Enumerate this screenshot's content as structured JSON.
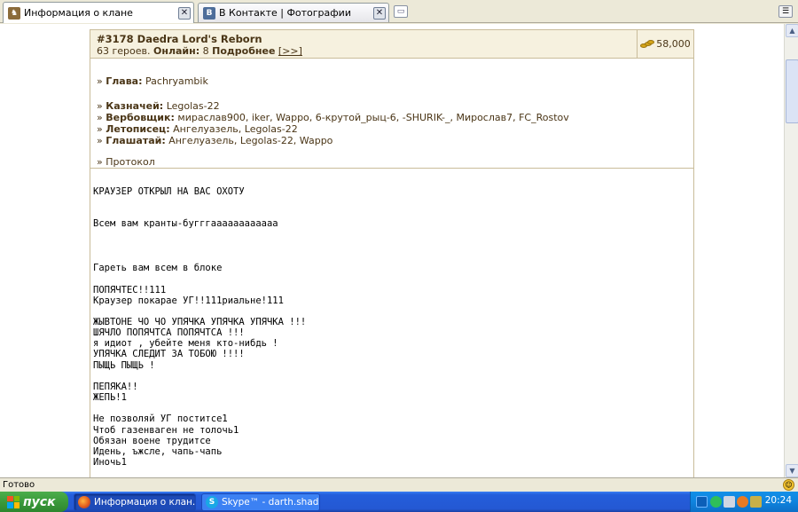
{
  "tabs": [
    {
      "title": "Информация о клане",
      "icon": "clan-icon",
      "close": "✕"
    },
    {
      "title": "В Контакте | Фотографии",
      "icon": "vk-icon",
      "close": "✕"
    }
  ],
  "clan": {
    "title": "#3178 Daedra Lord's Reborn",
    "heroes": "63 героев.",
    "online_label": "Онлайн:",
    "online_count": "8",
    "more_label": "Подробнее",
    "more_link": "[>>]",
    "gold": "58,000"
  },
  "officers": [
    {
      "prefix": "» ",
      "role": "Глава:",
      "names": "Pachryambik"
    },
    {
      "prefix": "» ",
      "role": "Казначей:",
      "names": "Legolas-22"
    },
    {
      "prefix": "» ",
      "role": "Вербовщик:",
      "names": "мираслав900, iker, Wappo, 6-крутой_рыц-6, -SHURIK-_, Мирослав7, FC_Rostov"
    },
    {
      "prefix": "» ",
      "role": "Летописец:",
      "names": "Ангелуазель, Legolas-22"
    },
    {
      "prefix": "» ",
      "role": "Глашатай:",
      "names": "Ангелуазель, Legolas-22, Wappo"
    }
  ],
  "protocol_link": "» Протокол",
  "history_lines": [
    "КРАУЗЕР ОТКРЫЛ НА ВАС ОХОТУ",
    "Всем вам кранты-бугггaааааааааааа",
    "Гареть вам всем в блоке",
    "ПОПЯЧТЕС!!111",
    "Краузер покарае УГ!!111риальне!111",
    "ЖЫВТОНЕ ЧО ЧО УПЯЧКА УПЯЧКА УПЯЧКА !!!",
    "ШЯЧЛО ПОПЯЧТСА ПОПЯЧТСА !!!",
    "я идиот , убейте меня кто-нибдь !",
    "УПЯЧКА СЛЕДИТ ЗА ТОБОЮ !!!!",
    "ПЫЩЬ ПЫЩЬ !",
    "ПЕПЯКА!!",
    "ЖЕПЬ!1",
    "Не позволяй УГ поститсе1",
    "Чтоб газенваген не толочь1",
    "Обязан воене трудитсе",
    "Идень, ъжсле, чапь-чапь",
    "Иночь1",
    "· · · · · · ·"
  ],
  "status_text": "Готово",
  "taskbar": {
    "start_label": "пуск",
    "tasks": [
      {
        "title": "Информация о клан...",
        "icon": "firefox-icon"
      },
      {
        "title": "Skype™ - darth.shad...",
        "icon": "skype-icon"
      }
    ],
    "clock": "20:24"
  },
  "colors": {
    "clan_text": "#4a3516",
    "clan_border": "#c9bc9a",
    "clan_header_bg": "#f6f1df",
    "taskbar_blue": "#245edb",
    "start_green": "#3a9a3a"
  }
}
